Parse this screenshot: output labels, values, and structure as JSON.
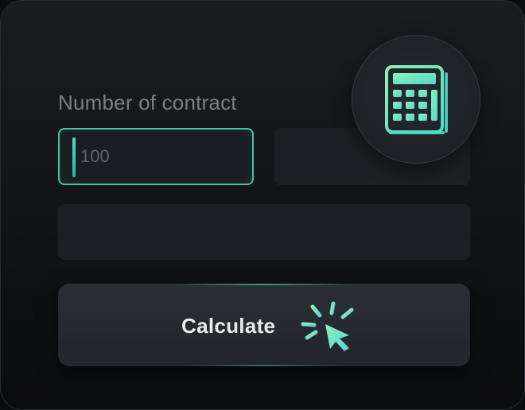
{
  "form": {
    "label": "Number of contract",
    "contract_input": {
      "value": "100"
    }
  },
  "actions": {
    "calculate_label": "Calculate"
  },
  "icons": {
    "badge": "calculator-icon",
    "button": "click-cursor-icon"
  },
  "colors": {
    "accent": "#3dc7a1",
    "accent_light": "#7ee8c4",
    "background": "#111316",
    "input_bg": "#1c1f23",
    "label": "#7b7f85",
    "button_text": "#e9ecef"
  }
}
